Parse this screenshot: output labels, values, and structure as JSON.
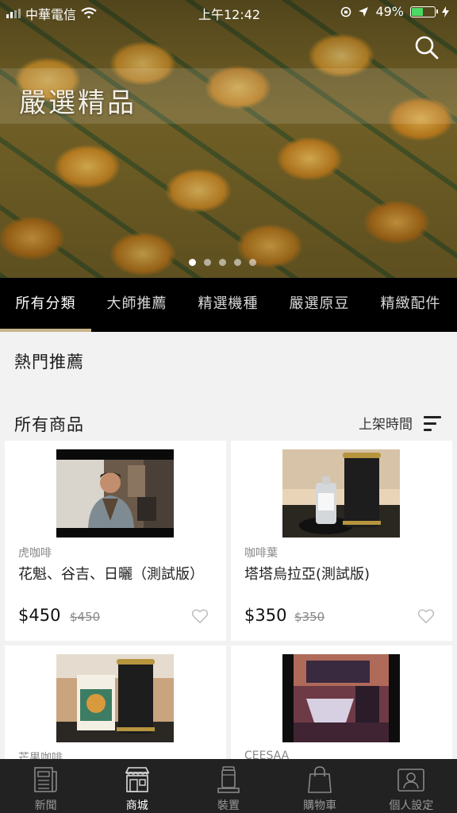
{
  "status_bar": {
    "carrier": "中華電信",
    "time": "上午12:42",
    "battery": "49%",
    "battery_level": 0.49
  },
  "hero": {
    "title": "嚴選精品",
    "slides": 5,
    "active_slide": 0
  },
  "tabs": [
    {
      "label": "所有分類",
      "active": true
    },
    {
      "label": "大師推薦",
      "active": false
    },
    {
      "label": "精選機種",
      "active": false
    },
    {
      "label": "嚴選原豆",
      "active": false
    },
    {
      "label": "精緻配件",
      "active": false
    }
  ],
  "sections": {
    "hot": "熱門推薦",
    "all": "所有商品",
    "sort_label": "上架時間"
  },
  "products": [
    {
      "category": "虎咖啡",
      "name": "花魁、谷吉、日曬（測試版）",
      "price": "$450",
      "original_price": "$450"
    },
    {
      "category": "咖啡葉",
      "name": "塔塔烏拉亞(測試版)",
      "price": "$350",
      "original_price": "$350"
    },
    {
      "category": "芒果咖啡",
      "name": "",
      "price": "",
      "original_price": ""
    },
    {
      "category": "CEESAA",
      "name": "",
      "price": "",
      "original_price": ""
    }
  ],
  "bottom_nav": [
    {
      "label": "新聞",
      "icon": "newspaper-icon",
      "active": false
    },
    {
      "label": "商城",
      "icon": "store-icon",
      "active": true
    },
    {
      "label": "裝置",
      "icon": "device-icon",
      "active": false
    },
    {
      "label": "購物車",
      "icon": "cart-bag-icon",
      "active": false
    },
    {
      "label": "個人設定",
      "icon": "profile-card-icon",
      "active": false
    }
  ],
  "colors": {
    "tab_underline": "#c8b48a",
    "background": "#f2f2f2",
    "nav_background": "#222222"
  }
}
